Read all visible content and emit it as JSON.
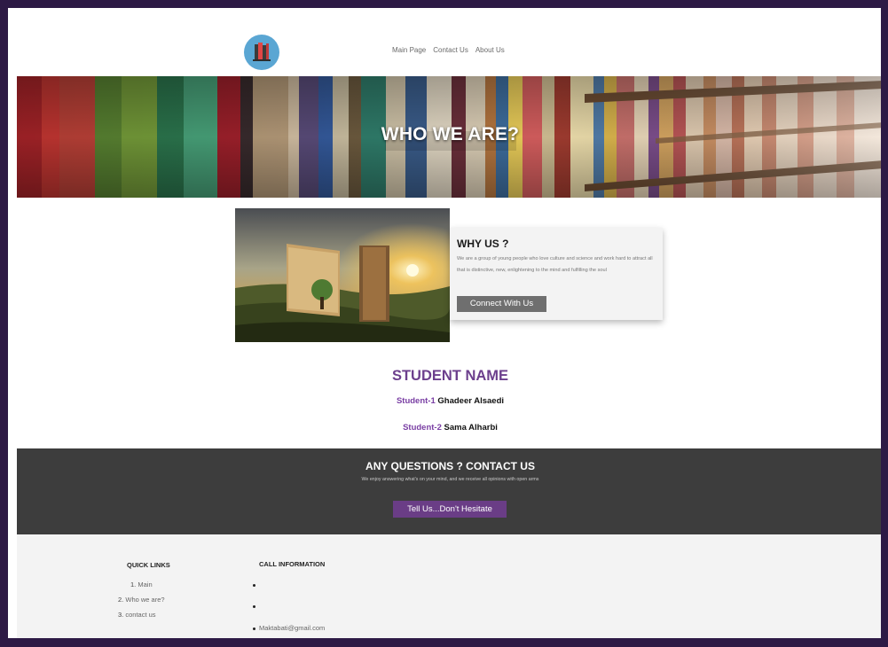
{
  "header": {
    "logo": "bookshelf-logo-icon",
    "nav": [
      {
        "label": "Main Page"
      },
      {
        "label": "Contact Us"
      },
      {
        "label": "About Us"
      }
    ]
  },
  "hero": {
    "title": "WHO WE ARE?"
  },
  "why_us": {
    "title": "WHY US ?",
    "text": "We are a group of young people who love culture and science and work hard to attract all that is distinctive, new, enlightening to the mind and fulfilling the soul",
    "button": "Connect With Us"
  },
  "students": {
    "heading": "STUDENT NAME",
    "list": [
      {
        "id": "Student-1",
        "name": "Ghadeer Alsaedi"
      },
      {
        "id": "Student-2",
        "name": "Sama Alharbi"
      }
    ]
  },
  "contact": {
    "title": "ANY QUESTIONS ? CONTACT US",
    "text": "We enjoy answering what's on your mind, and we receive all opinions with open arms",
    "button": "Tell Us...Don't Hesitate"
  },
  "footer": {
    "quick_links_title": "QUICK LINKS",
    "quick_links": [
      {
        "num": "1.",
        "label": "Main"
      },
      {
        "num": "2.",
        "label": "Who we are?"
      },
      {
        "num": "3.",
        "label": "contact us"
      }
    ],
    "call_title": "CALL INFORMATION",
    "email": "Maktabati@gmail.com"
  },
  "colors": {
    "frame": "#2d1a45",
    "accent_purple": "#6a3d86",
    "contact_bg": "#3d3d3d",
    "footer_bg": "#f3f3f3"
  }
}
